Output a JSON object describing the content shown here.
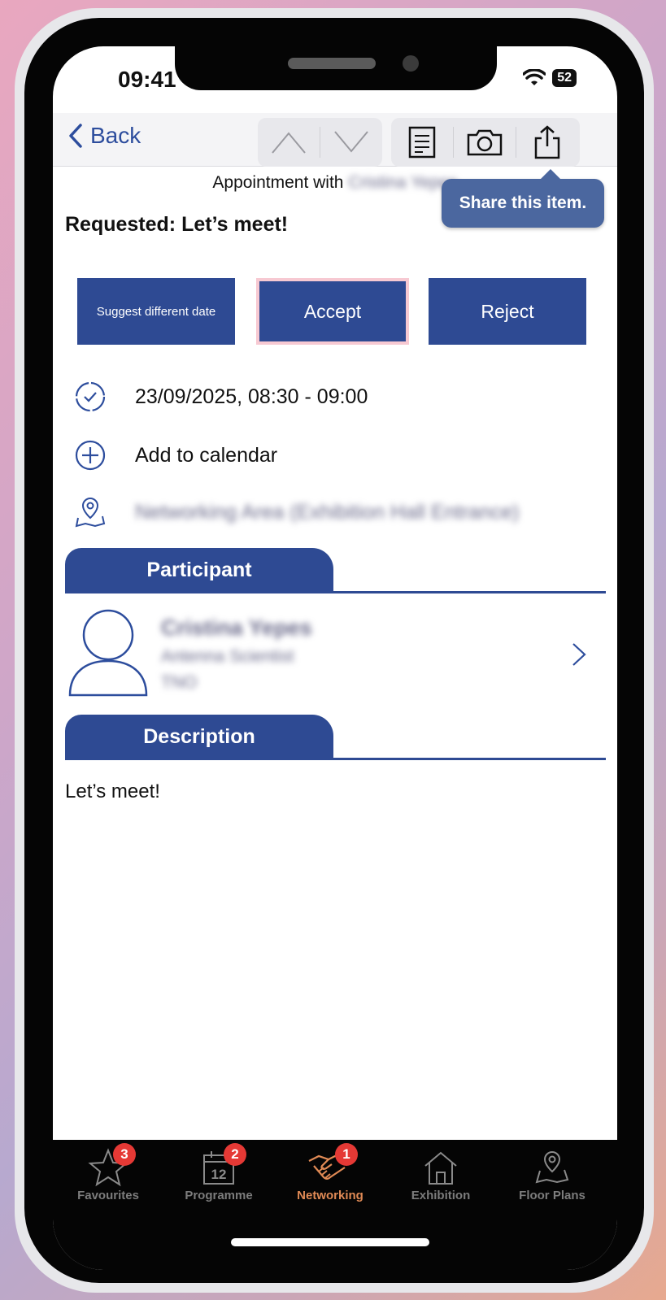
{
  "status": {
    "time": "09:41",
    "battery": "52"
  },
  "nav": {
    "back_label": "Back"
  },
  "header": {
    "subtitle_prefix": "Appointment with",
    "subtitle_name": "Cristina Yepes",
    "tooltip": "Share this item."
  },
  "request": {
    "status_text": "Requested: Let’s meet!"
  },
  "actions": {
    "suggest_label": "Suggest different date",
    "accept_label": "Accept",
    "reject_label": "Reject"
  },
  "details": {
    "datetime": "23/09/2025, 08:30 - 09:00",
    "add_calendar": "Add to calendar",
    "location": "Networking Area (Exhibition Hall Entrance)"
  },
  "participant": {
    "section_title": "Participant",
    "name": "Cristina Yepes",
    "role": "Antenna Scientist",
    "org": "TNO"
  },
  "description": {
    "section_title": "Description",
    "text": "Let’s meet!"
  },
  "tabbar": {
    "items": [
      {
        "label": "Favourites",
        "badge": "3",
        "icon": "star-icon"
      },
      {
        "label": "Programme",
        "badge": "2",
        "icon": "calendar-icon"
      },
      {
        "label": "Networking",
        "badge": "1",
        "icon": "handshake-icon"
      },
      {
        "label": "Exhibition",
        "badge": "",
        "icon": "house-icon"
      },
      {
        "label": "Floor Plans",
        "badge": "",
        "icon": "map-pin-icon"
      }
    ],
    "active_color": "#e08a55"
  },
  "colors": {
    "primary": "#2e4a93",
    "accent": "#2d4d9d",
    "badge": "#e53935"
  }
}
